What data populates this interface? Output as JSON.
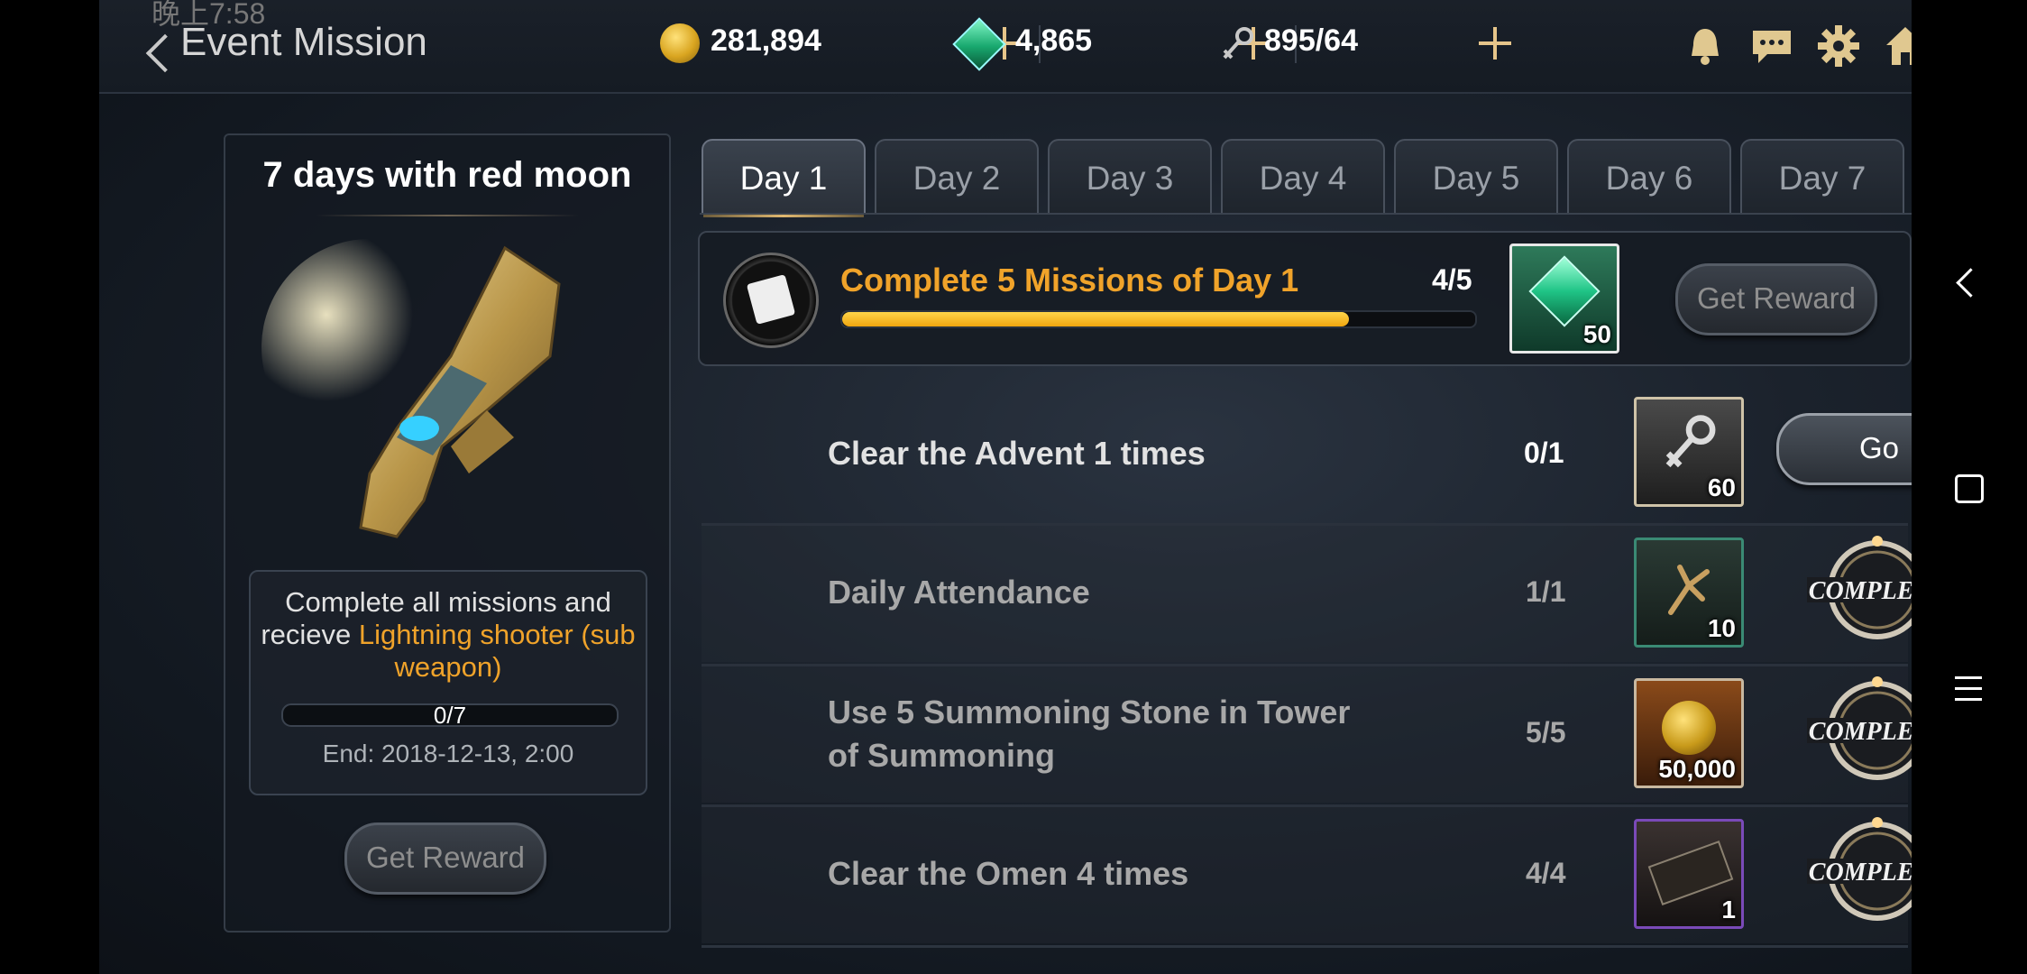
{
  "status_bar": {
    "time": "晚上7:58"
  },
  "header": {
    "title": "Event Mission",
    "gold": "281,894",
    "gems": "4,865",
    "keys": "895/64"
  },
  "left_panel": {
    "title": "7 days with red moon",
    "desc_prefix": "Complete all missions and recieve ",
    "desc_highlight": "Lightning shooter (sub weapon)",
    "progress_text": "0/7",
    "progress_fraction": 0.0,
    "end": "End: 2018-12-13, 2:00",
    "button": "Get Reward"
  },
  "tabs": [
    "Day 1",
    "Day 2",
    "Day 3",
    "Day 4",
    "Day 5",
    "Day 6",
    "Day 7"
  ],
  "active_tab": 0,
  "summary": {
    "title": "Complete 5 Missions of Day 1",
    "count": "4/5",
    "progress_fraction": 0.8,
    "reward_qty": "50",
    "button": "Get Reward"
  },
  "missions": [
    {
      "title": "Clear the Advent 1 times",
      "count": "0/1",
      "reward_qty": "60",
      "reward_icon": "key-icon",
      "action": "Go",
      "done": false
    },
    {
      "title": "Daily Attendance",
      "count": "1/1",
      "reward_qty": "10",
      "reward_icon": "branch-icon",
      "action": "COMPLETE",
      "done": true
    },
    {
      "title": "Use 5 Summoning Stone in Tower of Summoning",
      "count": "5/5",
      "reward_qty": "50,000",
      "reward_icon": "gold-coin-icon",
      "action": "COMPLETE",
      "done": true
    },
    {
      "title": "Clear the Omen 4 times",
      "count": "4/4",
      "reward_qty": "1",
      "reward_icon": "ticket-icon",
      "action": "COMPLETE",
      "done": true
    }
  ],
  "colors": {
    "accent": "#f0a32a",
    "progress": "#f5b81c",
    "text": "#e2e2e2"
  }
}
